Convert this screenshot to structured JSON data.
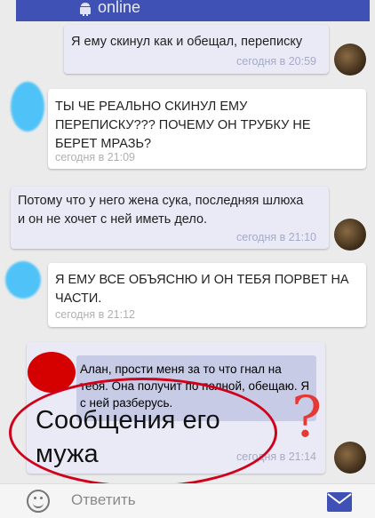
{
  "header": {
    "status": "online"
  },
  "messages": [
    {
      "text": "Я ему скинул как и обещал, переписку",
      "time": "сегодня в 20:59"
    },
    {
      "text": "ТЫ ЧЕ РЕАЛЬНО СКИНУЛ ЕМУ ПЕРЕПИСКУ??? ПОЧЕМУ ОН ТРУБКУ НЕ БЕРЕТ МРАЗЬ?",
      "time": "сегодня в 21:09"
    },
    {
      "text": "Потому что у него жена сука, последняя шлюха и он не хочет с ней иметь дело.",
      "time": "сегодня в 21:10"
    },
    {
      "text": "Я ЕМУ ВСЕ ОБЪЯСНЮ И ОН ТЕБЯ ПОРВЕТ НА ЧАСТИ.",
      "time": "сегодня в 21:12"
    },
    {
      "quote": "Алан, прости меня за то что гнал на тебя. Она получит по полной, обещаю. Я с ней разберусь.",
      "time": "сегодня в 21:14"
    }
  ],
  "annotation": {
    "text": "Сообщения его мужа",
    "mark": "?"
  },
  "composer": {
    "placeholder": "Ответить",
    "emoji_icon": "smiley-icon",
    "send_icon": "envelope-icon"
  },
  "colors": {
    "accent": "#3f51b5",
    "annotation": "#d0021b",
    "censor_blue": "#4fc3f7",
    "censor_red": "#d50000"
  }
}
